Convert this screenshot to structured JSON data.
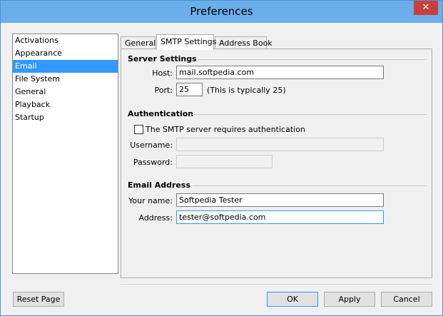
{
  "window": {
    "title": "Preferences",
    "close_label": "✕"
  },
  "sidebar": {
    "items": [
      {
        "label": "Activations",
        "selected": false
      },
      {
        "label": "Appearance",
        "selected": false
      },
      {
        "label": "Email",
        "selected": true
      },
      {
        "label": "File System",
        "selected": false
      },
      {
        "label": "General",
        "selected": false
      },
      {
        "label": "Playback",
        "selected": false
      },
      {
        "label": "Startup",
        "selected": false
      }
    ]
  },
  "tabs": [
    {
      "label": "General",
      "active": false
    },
    {
      "label": "SMTP Settings",
      "active": true
    },
    {
      "label": "Address Book",
      "active": false
    }
  ],
  "server_settings": {
    "title": "Server Settings",
    "host_label": "Host:",
    "host_value": "mail.softpedia.com",
    "port_label": "Port:",
    "port_value": "25",
    "port_hint": "(This is typically 25)"
  },
  "authentication": {
    "title": "Authentication",
    "checkbox_label": "The SMTP server requires authentication",
    "checked": false,
    "username_label": "Username:",
    "username_value": "",
    "password_label": "Password:",
    "password_value": ""
  },
  "email_address": {
    "title": "Email Address",
    "name_label": "Your name:",
    "name_value": "Softpedia Tester",
    "address_label": "Address:",
    "address_value": "tester@softpedia.com"
  },
  "footer": {
    "reset_label": "Reset Page",
    "ok_label": "OK",
    "apply_label": "Apply",
    "cancel_label": "Cancel"
  },
  "colors": {
    "titlebar": "#6baeec",
    "selection": "#3399ff",
    "close": "#c9403a"
  }
}
